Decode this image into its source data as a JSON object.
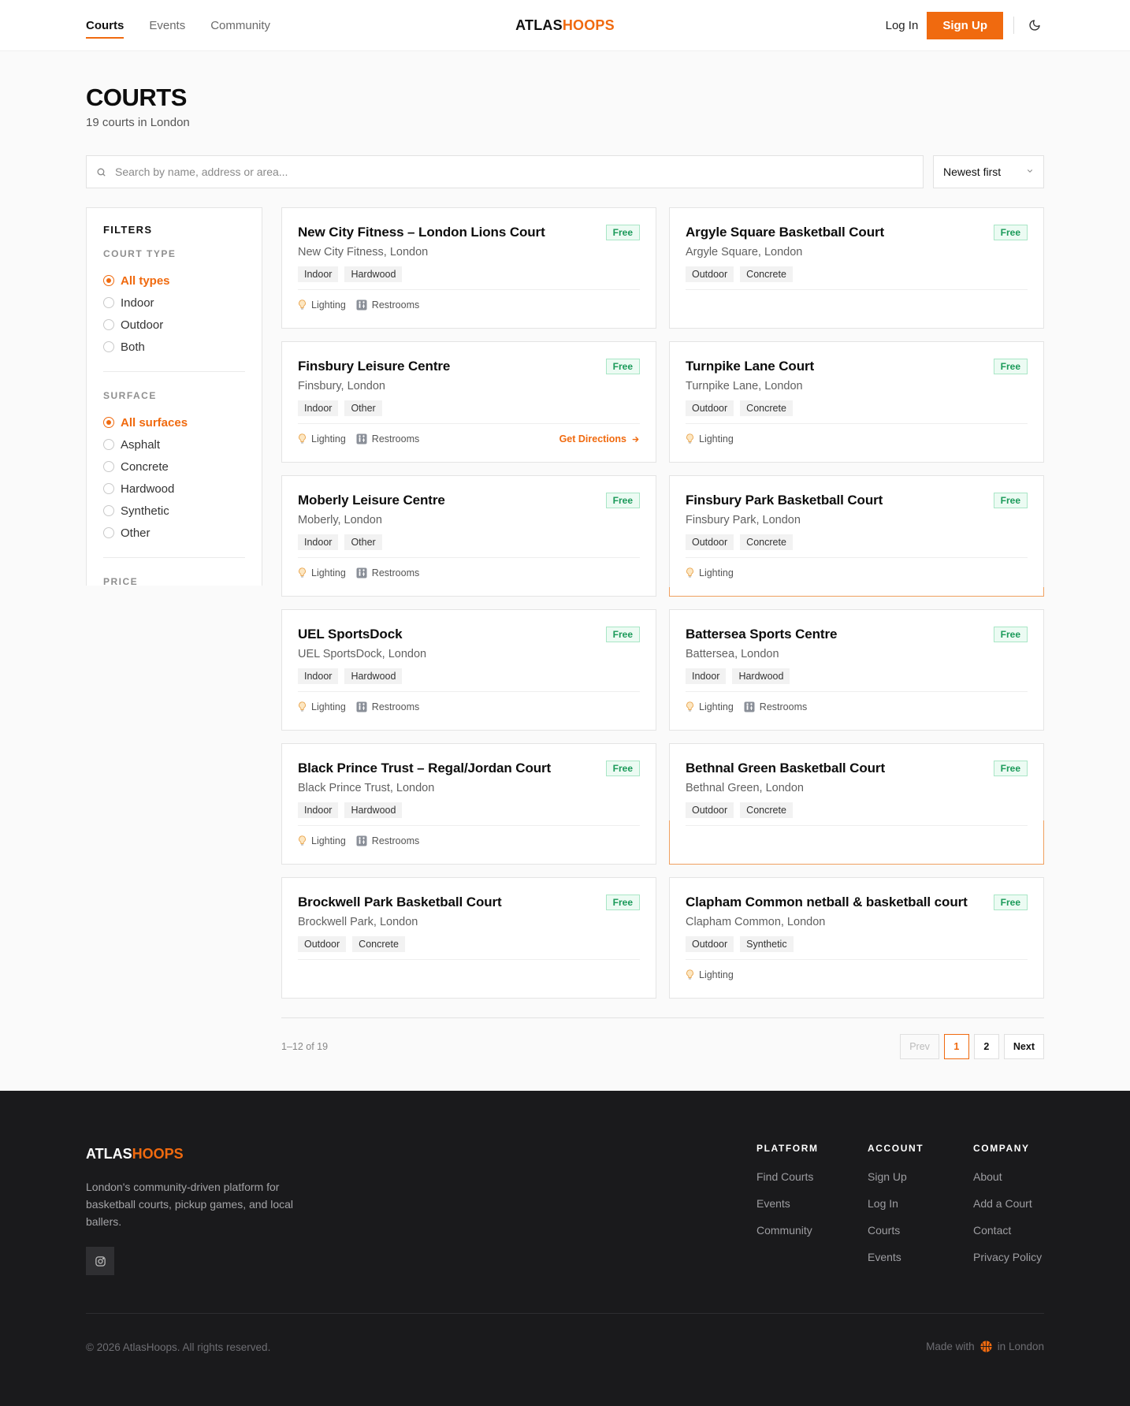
{
  "nav": {
    "items": [
      {
        "label": "Courts",
        "active": true
      },
      {
        "label": "Events",
        "active": false
      },
      {
        "label": "Community",
        "active": false
      }
    ],
    "logo_a": "ATLAS",
    "logo_b": "HOOPS",
    "login": "Log In",
    "signup": "Sign Up"
  },
  "page": {
    "title": "COURTS",
    "subtitle": "19 courts in London"
  },
  "search": {
    "placeholder": "Search by name, address or area...",
    "value": ""
  },
  "sort": {
    "selected": "Newest first"
  },
  "filters": {
    "title": "FILTERS",
    "court_type": {
      "title": "COURT TYPE",
      "options": [
        "All types",
        "Indoor",
        "Outdoor",
        "Both"
      ],
      "selected_index": 0
    },
    "surface": {
      "title": "SURFACE",
      "options": [
        "All surfaces",
        "Asphalt",
        "Concrete",
        "Hardwood",
        "Synthetic",
        "Other"
      ],
      "selected_index": 0
    },
    "price": {
      "title": "PRICE"
    }
  },
  "courts": [
    {
      "name": "New City Fitness – London Lions Court",
      "location": "New City Fitness, London",
      "badge": "Free",
      "tags": [
        "Indoor",
        "Hardwood"
      ],
      "amenities": [
        "Lighting",
        "Restrooms"
      ],
      "directions": ""
    },
    {
      "name": "Argyle Square Basketball Court",
      "location": "Argyle Square, London",
      "badge": "Free",
      "tags": [
        "Outdoor",
        "Concrete"
      ],
      "amenities": [],
      "directions": ""
    },
    {
      "name": "Finsbury Leisure Centre",
      "location": "Finsbury, London",
      "badge": "Free",
      "tags": [
        "Indoor",
        "Other"
      ],
      "amenities": [
        "Lighting",
        "Restrooms"
      ],
      "directions": "Get Directions"
    },
    {
      "name": "Turnpike Lane Court",
      "location": "Turnpike Lane, London",
      "badge": "Free",
      "tags": [
        "Outdoor",
        "Concrete"
      ],
      "amenities": [
        "Lighting"
      ],
      "directions": ""
    },
    {
      "name": "Moberly Leisure Centre",
      "location": "Moberly, London",
      "badge": "Free",
      "tags": [
        "Indoor",
        "Other"
      ],
      "amenities": [
        "Lighting",
        "Restrooms"
      ],
      "directions": ""
    },
    {
      "name": "Finsbury Park Basketball Court",
      "location": "Finsbury Park, London",
      "badge": "Free",
      "tags": [
        "Outdoor",
        "Concrete"
      ],
      "amenities": [
        "Lighting"
      ],
      "directions": ""
    },
    {
      "name": "UEL SportsDock",
      "location": "UEL SportsDock, London",
      "badge": "Free",
      "tags": [
        "Indoor",
        "Hardwood"
      ],
      "amenities": [
        "Lighting",
        "Restrooms"
      ],
      "directions": ""
    },
    {
      "name": "Battersea Sports Centre",
      "location": "Battersea, London",
      "badge": "Free",
      "tags": [
        "Indoor",
        "Hardwood"
      ],
      "amenities": [
        "Lighting",
        "Restrooms"
      ],
      "directions": ""
    },
    {
      "name": "Black Prince Trust – Regal/Jordan Court",
      "location": "Black Prince Trust, London",
      "badge": "Free",
      "tags": [
        "Indoor",
        "Hardwood"
      ],
      "amenities": [
        "Lighting",
        "Restrooms"
      ],
      "directions": ""
    },
    {
      "name": "Bethnal Green Basketball Court",
      "location": "Bethnal Green, London",
      "badge": "Free",
      "tags": [
        "Outdoor",
        "Concrete"
      ],
      "amenities": [],
      "directions": ""
    },
    {
      "name": "Brockwell Park Basketball Court",
      "location": "Brockwell Park, London",
      "badge": "Free",
      "tags": [
        "Outdoor",
        "Concrete"
      ],
      "amenities": [],
      "directions": ""
    },
    {
      "name": "Clapham Common netball & basketball court",
      "location": "Clapham Common, London",
      "badge": "Free",
      "tags": [
        "Outdoor",
        "Synthetic"
      ],
      "amenities": [
        "Lighting"
      ],
      "directions": ""
    }
  ],
  "pagination": {
    "range": "1–12 of 19",
    "prev": "Prev",
    "pages": [
      "1",
      "2"
    ],
    "current": "1",
    "next": "Next"
  },
  "footer": {
    "logo_a": "ATLAS",
    "logo_b": "HOOPS",
    "description": "London's community-driven platform for basketball courts, pickup games, and local ballers.",
    "columns": [
      {
        "title": "PLATFORM",
        "links": [
          "Find Courts",
          "Events",
          "Community"
        ]
      },
      {
        "title": "ACCOUNT",
        "links": [
          "Sign Up",
          "Log In",
          "Courts",
          "Events"
        ]
      },
      {
        "title": "COMPANY",
        "links": [
          "About",
          "Add a Court",
          "Contact",
          "Privacy Policy"
        ]
      }
    ],
    "copyright": "© 2026 AtlasHoops. All rights reserved.",
    "made_with_prefix": "Made with",
    "made_with_suffix": "in London"
  },
  "colors": {
    "accent": "#f06a0f",
    "badge_green": "#1a9a59",
    "footer_bg": "#1a1a1c"
  }
}
